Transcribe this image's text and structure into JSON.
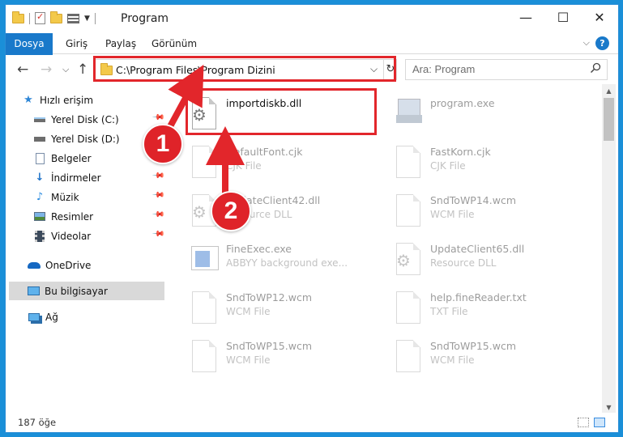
{
  "window": {
    "title": "Program",
    "controls": {
      "minimize": "—",
      "maximize": "☐",
      "close": "✕"
    }
  },
  "ribbon": {
    "tabs": [
      "Dosya",
      "Giriş",
      "Paylaş",
      "Görünüm"
    ],
    "help": "?"
  },
  "address": {
    "path": "C:\\Program Files\\Program Dizini",
    "search_placeholder": "Ara: Program"
  },
  "sidebar": {
    "items": [
      {
        "label": "Hızlı erişim",
        "icon": "star-icon",
        "pinned": false
      },
      {
        "label": "Yerel Disk (C:)",
        "icon": "drive-icon",
        "pinned": true
      },
      {
        "label": "Yerel Disk (D:)",
        "icon": "drive-icon",
        "pinned": false
      },
      {
        "label": "Belgeler",
        "icon": "documents-icon",
        "pinned": true
      },
      {
        "label": "İndirmeler",
        "icon": "downloads-icon",
        "pinned": true
      },
      {
        "label": "Müzik",
        "icon": "music-icon",
        "pinned": true
      },
      {
        "label": "Resimler",
        "icon": "pictures-icon",
        "pinned": true
      },
      {
        "label": "Videolar",
        "icon": "videos-icon",
        "pinned": true
      },
      {
        "label": "OneDrive",
        "icon": "cloud-icon",
        "pinned": false
      },
      {
        "label": "Bu bilgisayar",
        "icon": "computer-icon",
        "pinned": false
      },
      {
        "label": "Ağ",
        "icon": "network-icon",
        "pinned": false
      }
    ]
  },
  "files": [
    {
      "name": "importdiskb.dll",
      "type": "",
      "icon": "dll-icon"
    },
    {
      "name": "program.exe",
      "type": "",
      "icon": "exe-icon"
    },
    {
      "name": "DefaultFont.cjk",
      "type": "CJK File",
      "icon": "file-icon"
    },
    {
      "name": "FastKorn.cjk",
      "type": "CJK File",
      "icon": "file-icon"
    },
    {
      "name": "UpdateClient42.dll",
      "type": "Resource DLL",
      "icon": "dll-icon"
    },
    {
      "name": "SndToWP14.wcm",
      "type": "WCM File",
      "icon": "file-icon"
    },
    {
      "name": "FineExec.exe",
      "type": "ABBYY background exe...",
      "icon": "exe-icon"
    },
    {
      "name": "UpdateClient65.dll",
      "type": "Resource DLL",
      "icon": "dll-icon"
    },
    {
      "name": "SndToWP12.wcm",
      "type": "WCM File",
      "icon": "file-icon"
    },
    {
      "name": "help.fineReader.txt",
      "type": "TXT File",
      "icon": "file-icon"
    },
    {
      "name": "SndToWP15.wcm",
      "type": "WCM File",
      "icon": "file-icon"
    },
    {
      "name": "SndToWP15.wcm",
      "type": "WCM File",
      "icon": "file-icon"
    }
  ],
  "status": {
    "count": "187 öğe"
  },
  "annotations": {
    "step1": "1",
    "step2": "2",
    "color": "#e2262b"
  }
}
